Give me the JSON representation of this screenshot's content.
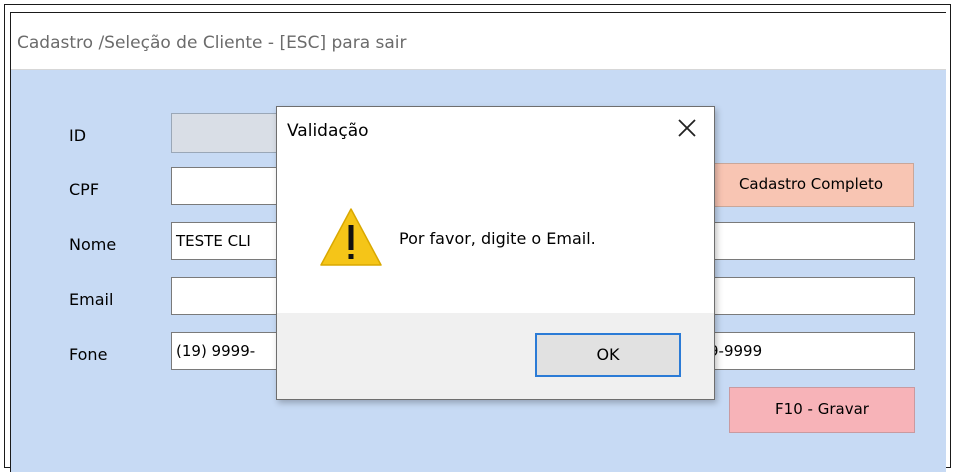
{
  "window": {
    "title": "Cadastro /Seleção de Cliente - [ESC] para sair"
  },
  "form": {
    "id_label": "ID",
    "cpf_label": "CPF",
    "nome_label": "Nome",
    "email_label": "Email",
    "fone_label": "Fone",
    "id_value": "",
    "cpf_value": "",
    "nome_value": "TESTE CLI",
    "email_value": "",
    "fone1_value": "(19) 9999-",
    "fone2_value": "9-9999",
    "cadastro_completo_label": "Cadastro Completo",
    "gravar_label": "F10 - Gravar"
  },
  "dialog": {
    "title": "Validação",
    "message": "Por favor, digite o Email.",
    "ok_label": "OK",
    "icon": "warning-icon",
    "close_icon": "close-icon"
  },
  "colors": {
    "window_bg": "#c7daf4",
    "cadastro_button": "#f8c5b3",
    "gravar_button": "#f7b3b8",
    "ok_focus_border": "#2b7bd6",
    "warning": "#f5c518"
  }
}
